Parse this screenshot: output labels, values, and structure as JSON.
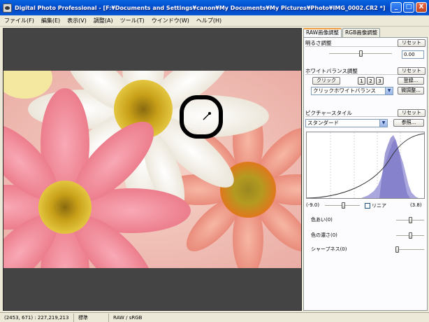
{
  "window": {
    "title": "Digital Photo Professional - [F:¥Documents and Settings¥canon¥My Documents¥My Pictures¥Photo¥IMG_0002.CR2 *]",
    "minimize": "_",
    "maximize": "□",
    "close": "X"
  },
  "menu": [
    "ファイル(F)",
    "編集(E)",
    "表示(V)",
    "調整(A)",
    "ツール(T)",
    "ウインドウ(W)",
    "ヘルプ(H)"
  ],
  "panel": {
    "tabs": [
      "RAW画像調整",
      "RGB画像調整"
    ],
    "brightness": {
      "label": "明るさ調整",
      "reset": "リセット",
      "value": "0.00",
      "slider_level": 0.5
    },
    "white_balance": {
      "label": "ホワイトバランス調整",
      "reset": "リセット",
      "click_button": "クリック",
      "num_buttons": [
        "1",
        "2",
        "3"
      ],
      "register_button": "登録...",
      "selected": "クリックホワイトバランス",
      "fine_tune_button": "微調整..."
    },
    "picture_style": {
      "label": "ピクチャースタイル",
      "reset": "リセット",
      "selected": "スタンダード",
      "browse_button": "参照...",
      "range_min": "(-9.0)",
      "range_max": "(3.8)",
      "linear_label": "リニア",
      "linear_checked": false,
      "color_tone_label": "色あい(0)",
      "saturation_label": "色の濃さ(0)",
      "sharpness_label": "シャープネス(0)"
    }
  },
  "status": {
    "coords": "(2453, 671) : 227,219,213",
    "mode": "標準",
    "colorspace": "RAW / sRGB"
  },
  "colors": {
    "titlebar": "#0054e3",
    "viewer_bg": "#444444",
    "panel_bg": "#fcfcfe"
  },
  "icons": [
    "app-icon",
    "eyedropper-icon",
    "dropdown-arrow-icon"
  ]
}
